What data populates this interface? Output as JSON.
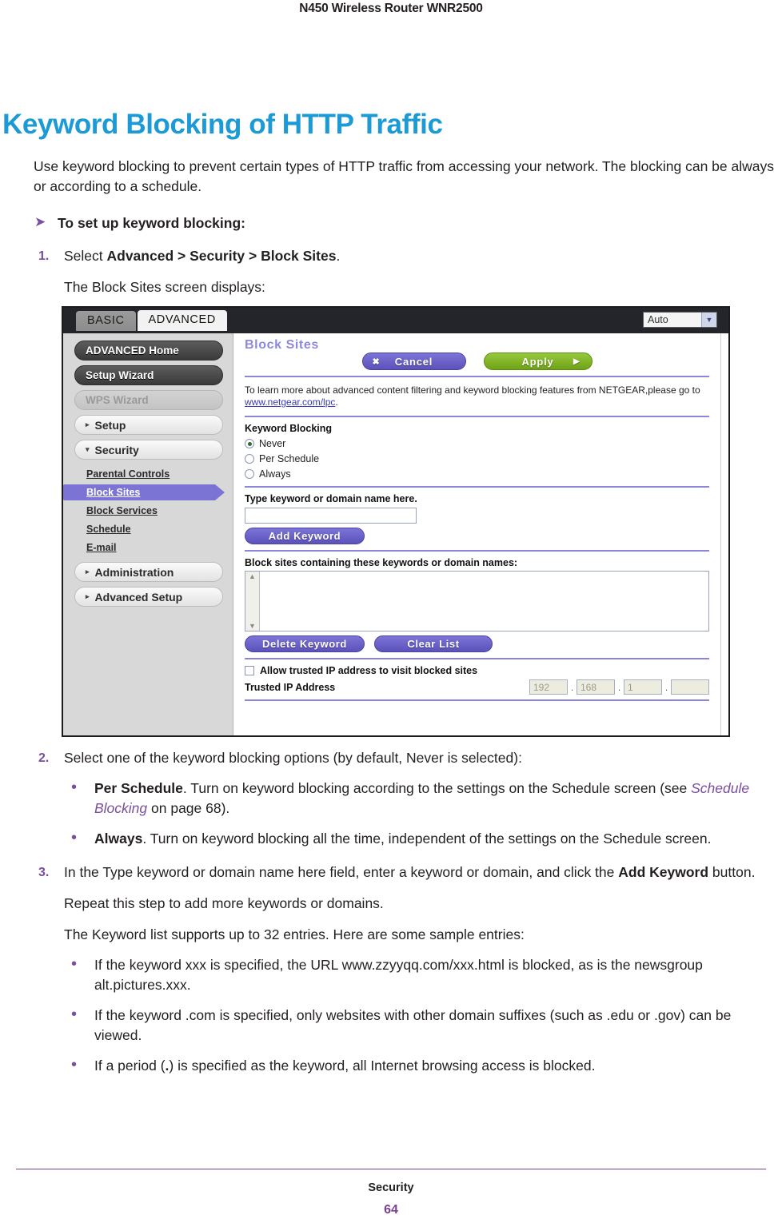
{
  "running_head": "N450 Wireless Router WNR2500",
  "page_title": "Keyword Blocking of HTTP Traffic",
  "intro": "Use keyword blocking to prevent certain types of HTTP traffic from accessing your network. The blocking can be always or according to a schedule.",
  "procedure_heading": "To set up keyword blocking:",
  "steps": {
    "s1_num": "1.",
    "s1_prefix": "Select ",
    "s1_bold": "Advanced > Security > Block Sites",
    "s1_suffix": ".",
    "s1_sub": "The Block Sites screen displays:",
    "s2_num": "2.",
    "s2_text": "Select one of the keyword blocking options (by default, Never is selected):",
    "s2_b1_bold": "Per Schedule",
    "s2_b1_text": ". Turn on keyword blocking according to the settings on the Schedule screen (see ",
    "s2_b1_link": "Schedule Blocking",
    "s2_b1_tail": " on page 68).",
    "s2_b2_bold": "Always",
    "s2_b2_text": ". Turn on keyword blocking all the time, independent of the settings on the Schedule screen.",
    "s3_num": "3.",
    "s3_pre": "In the Type keyword or domain name here field, enter a keyword or domain, and click the ",
    "s3_bold": "Add Keyword",
    "s3_post": " button.",
    "s3_sub1": "Repeat this step to add more keywords or domains.",
    "s3_sub2": "The Keyword list supports up to 32 entries. Here are some sample entries:",
    "s3_b1": "If the keyword xxx is specified, the URL www.zzyyqq.com/xxx.html is blocked, as is the newsgroup alt.pictures.xxx.",
    "s3_b2": "If the keyword .com is specified, only websites with other domain suffixes (such as .edu or .gov) can be viewed.",
    "s3_b3_pre": "If a period (",
    "s3_b3_bold": ".",
    "s3_b3_post": ") is specified as the keyword, all Internet browsing access is blocked."
  },
  "screenshot": {
    "tabs": {
      "basic": "BASIC",
      "advanced": "ADVANCED"
    },
    "language_select": {
      "value": "Auto"
    },
    "sidebar": {
      "buttons": [
        {
          "label": "ADVANCED Home",
          "style": "dark"
        },
        {
          "label": "Setup Wizard",
          "style": "dark"
        },
        {
          "label": "WPS Wizard",
          "style": "disabled"
        },
        {
          "label": "Setup",
          "style": "light",
          "tri": "▸"
        },
        {
          "label": "Security",
          "style": "light",
          "tri": "▾"
        }
      ],
      "subitems": [
        {
          "label": "Parental Controls",
          "active": false
        },
        {
          "label": "Block Sites",
          "active": true
        },
        {
          "label": "Block Services",
          "active": false
        },
        {
          "label": "Schedule",
          "active": false
        },
        {
          "label": "E-mail",
          "active": false
        }
      ],
      "buttons_tail": [
        {
          "label": "Administration",
          "style": "light",
          "tri": "▸"
        },
        {
          "label": "Advanced Setup",
          "style": "light",
          "tri": "▸"
        }
      ]
    },
    "panel": {
      "title": "Block Sites",
      "cancel_label": "Cancel",
      "apply_label": "Apply",
      "help_text": "To learn more about advanced content filtering and keyword blocking features from NETGEAR,please go to",
      "help_link": "www.netgear.com/lpc",
      "help_tail": ".",
      "keyword_blocking_label": "Keyword Blocking",
      "radios": [
        {
          "label": "Never",
          "selected": true
        },
        {
          "label": "Per Schedule",
          "selected": false
        },
        {
          "label": "Always",
          "selected": false
        }
      ],
      "type_keyword_label": "Type keyword or domain name here.",
      "keyword_input_value": "",
      "add_keyword_label": "Add Keyword",
      "list_label": "Block sites containing these keywords or domain names:",
      "delete_keyword_label": "Delete Keyword",
      "clear_list_label": "Clear List",
      "allow_trusted_label": "Allow trusted IP address to visit blocked sites",
      "trusted_ip_label": "Trusted IP Address",
      "trusted_ip_octets": [
        "192",
        "168",
        "1",
        ""
      ]
    }
  },
  "footer": {
    "chapter": "Security",
    "page": "64"
  },
  "colors": {
    "title_blue": "#1b9ad6",
    "accent_purple": "#7a4e9e",
    "ui_purple": "#7b74d4",
    "apply_green": "#6fa216"
  }
}
